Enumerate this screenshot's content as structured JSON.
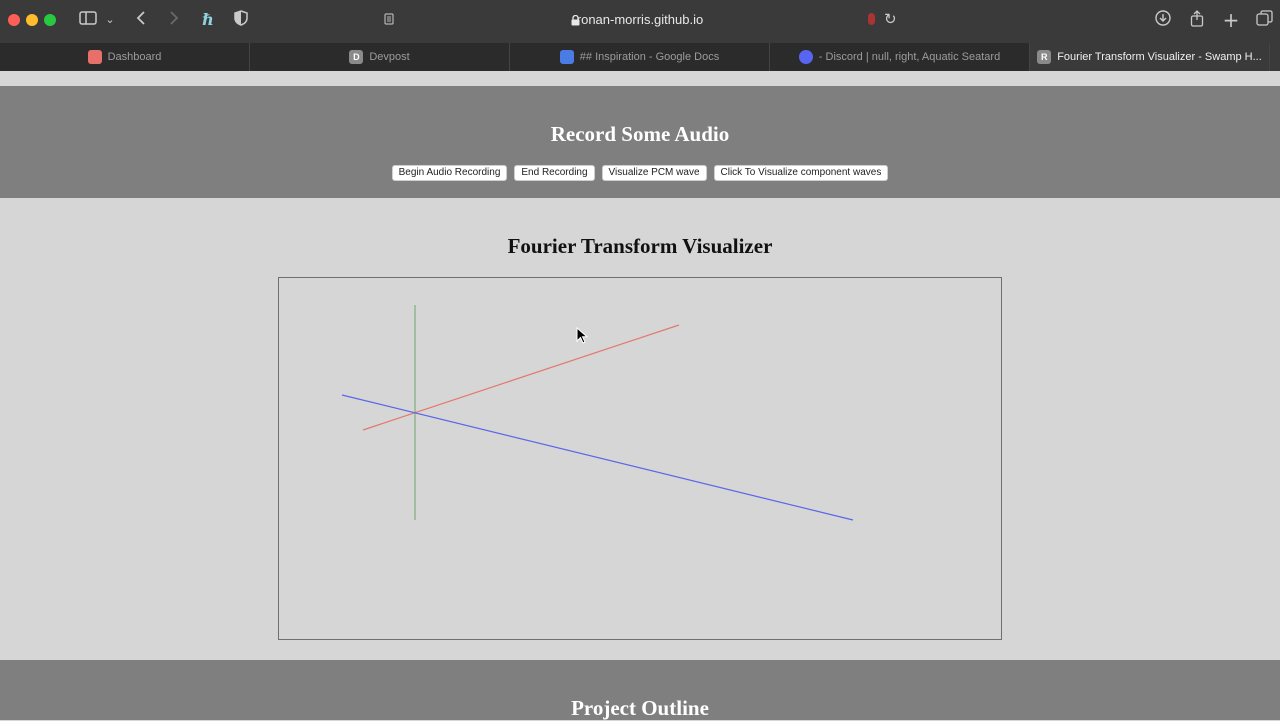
{
  "browser": {
    "url": "ronan-morris.github.io",
    "tabs": [
      {
        "label": "Dashboard",
        "favicon_color": "#e8706a",
        "favicon": "",
        "active": false
      },
      {
        "label": "Devpost",
        "favicon_color": "#8a8a8a",
        "favicon": "D",
        "active": false
      },
      {
        "label": "## Inspiration - Google Docs",
        "favicon_color": "#4b7be5",
        "favicon": "",
        "active": false
      },
      {
        "label": "- Discord | null, right, Aquatic Seatard",
        "favicon_color": "#5865f2",
        "favicon": "",
        "active": false
      },
      {
        "label": "Fourier Transform Visualizer - Swamp H...",
        "favicon_color": "#8a8a8a",
        "favicon": "R",
        "active": true
      }
    ]
  },
  "record": {
    "title": "Record Some Audio",
    "buttons": [
      "Begin Audio Recording",
      "End Recording",
      "Visualize PCM wave",
      "Click To Visualize component waves"
    ]
  },
  "visualizer": {
    "title": "Fourier Transform Visualizer",
    "colors": {
      "red_line": "#e07a6e",
      "blue_line": "#5b66e8",
      "green_line": "#7fae7f"
    }
  },
  "outline": {
    "title": "Project Outline"
  }
}
